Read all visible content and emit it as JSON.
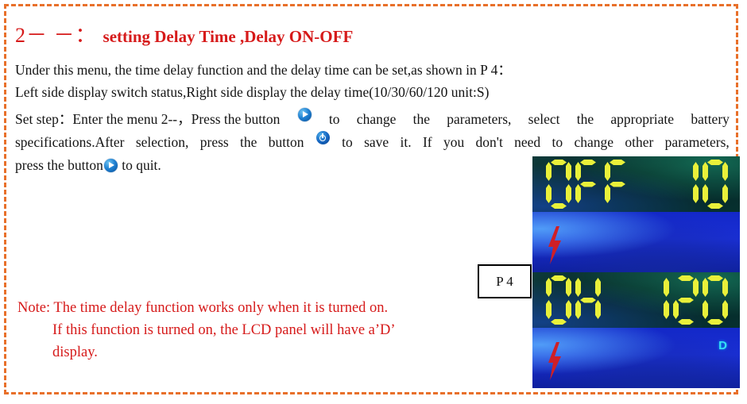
{
  "frame": {
    "border_color": "#e8702a",
    "style": "dashed"
  },
  "title": {
    "prefix": "2－ －：",
    "main": "setting Delay Time ,Delay ON-OFF",
    "color": "#d61a1a"
  },
  "body": {
    "line1": "Under this menu, the time delay function and the delay time can be set,as shown in P 4：",
    "line2": "Left side display switch status,Right side display the delay time(10/30/60/120 unit:S)",
    "set_step": {
      "seg1": "Set step：Enter the menu 2--，Press the button",
      "icon1": "play-button-icon",
      "seg2_a": "to",
      "seg2_b": "change",
      "seg2_c": "the",
      "seg2_d": "parameters,",
      "seg2_e": "select",
      "seg2_f": "the",
      "seg2_g": "appropriate",
      "seg2_h": "battery",
      "seg3_a": "specifications.After",
      "seg3_b": "selection,",
      "seg3_c": "press",
      "seg3_d": "the",
      "seg3_e": "button",
      "icon2": "power-button-icon",
      "seg3_f": "to",
      "seg3_g": "save",
      "seg3_h": "it.",
      "seg3_i": "If",
      "seg3_j": "you",
      "seg3_k": "don't",
      "seg3_l": "need",
      "seg3_m": "to",
      "seg3_n": "change",
      "seg3_o": "other",
      "seg3_p": "parameters,",
      "seg4_a": "press the button",
      "icon3": "play-button-icon",
      "seg4_b": "to quit."
    }
  },
  "note": {
    "line1": "Note: The time delay function works only when it is turned on.",
    "line2": "If this function is turned on, the LCD panel will have a’D’",
    "line3": "display.",
    "color": "#d61a1a"
  },
  "caption": {
    "p4_label": "P 4"
  },
  "lcd": {
    "segment_color": "#e9f03a",
    "body_color": "#1a2fd4",
    "bolt_color": "#d7222a",
    "d_color": "#35e0f5",
    "units": [
      {
        "name": "lcd-top",
        "left_text": "OFF",
        "right_text": "10",
        "left_digits": [
          "O",
          "F",
          "F"
        ],
        "right_digits": [
          "1",
          "0"
        ],
        "bolt": "lightning-bolt-icon",
        "d_flag": ""
      },
      {
        "name": "lcd-bottom",
        "left_text": "ON",
        "right_text": "120",
        "left_digits": [
          "O",
          "N"
        ],
        "right_digits": [
          "1",
          "2",
          "0"
        ],
        "bolt": "lightning-bolt-icon",
        "d_flag": "D"
      }
    ]
  }
}
